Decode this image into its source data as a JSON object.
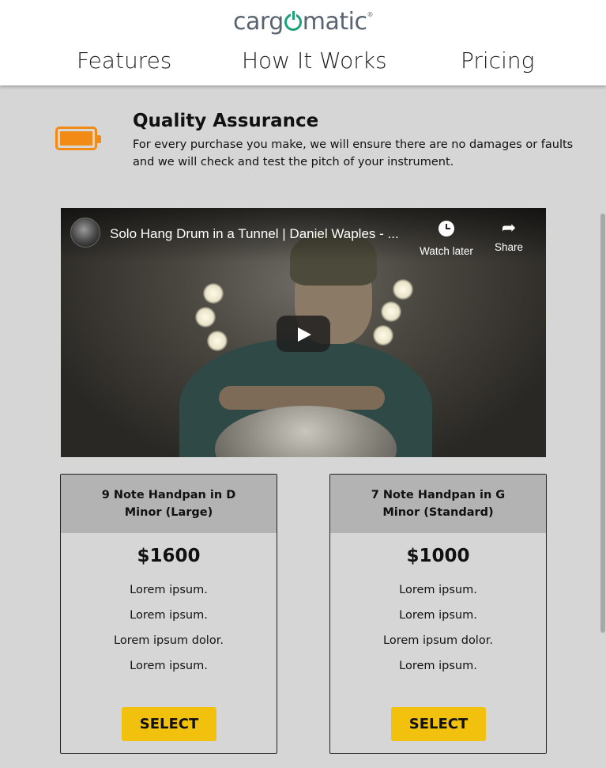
{
  "header": {
    "logo_pre": "carg",
    "logo_post": "matic",
    "logo_mark": "®",
    "nav": [
      "Features",
      "How It Works",
      "Pricing"
    ]
  },
  "quality": {
    "icon": "battery-icon",
    "title": "Quality Assurance",
    "text": "For every purchase you make, we will ensure there are no damages or faults and we will check and test the pitch of your instrument."
  },
  "video": {
    "title": "Solo Hang Drum in a Tunnel | Daniel Waples - ...",
    "watch_later": "Watch later",
    "share": "Share"
  },
  "cards": [
    {
      "title": "9 Note Handpan in D Minor (Large)",
      "price": "$1600",
      "features": [
        "Lorem ipsum.",
        "Lorem ipsum.",
        "Lorem ipsum dolor.",
        "Lorem ipsum."
      ],
      "button": "SELECT"
    },
    {
      "title": "7 Note Handpan in G Minor (Standard)",
      "price": "$1000",
      "features": [
        "Lorem ipsum.",
        "Lorem ipsum.",
        "Lorem ipsum dolor.",
        "Lorem ipsum."
      ],
      "button": "SELECT"
    }
  ],
  "colors": {
    "accent_orange": "#f28b16",
    "button_yellow": "#f2c10d",
    "logo_green": "#1aa37a",
    "background": "#d6d6d6"
  }
}
